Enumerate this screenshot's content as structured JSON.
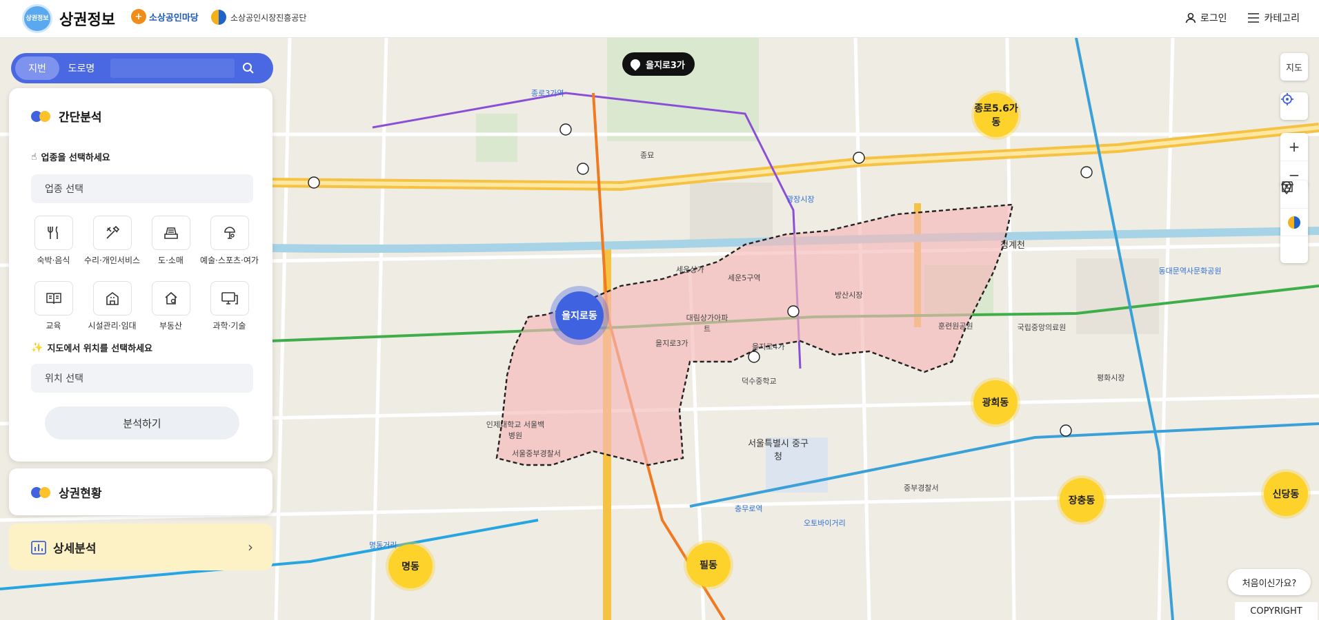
{
  "header": {
    "logo_badge": "상권정보",
    "title": "상권정보",
    "partner1": "소상공인마당",
    "partner2": "소상공인시장진흥공단",
    "login": "로그인",
    "category": "카테고리"
  },
  "search": {
    "tab_jibun": "지번",
    "tab_road": "도로명",
    "placeholder": ""
  },
  "quick": {
    "title": "간단분석",
    "industry_prompt": "업종을 선택하세요",
    "industry_field": "업종 선택",
    "categories": [
      {
        "label": "숙박·음식",
        "icon": "utensils-icon"
      },
      {
        "label": "수리·개인서비스",
        "icon": "tools-icon"
      },
      {
        "label": "도·소매",
        "icon": "register-icon"
      },
      {
        "label": "예술·스포츠·여가",
        "icon": "leisure-icon"
      },
      {
        "label": "교육",
        "icon": "book-icon"
      },
      {
        "label": "시설관리·임대",
        "icon": "building-icon"
      },
      {
        "label": "부동산",
        "icon": "house-icon"
      },
      {
        "label": "과학·기술",
        "icon": "monitor-icon"
      }
    ],
    "location_prompt": "지도에서 위치를 선택하세요",
    "location_field": "위치 선택",
    "analyze_button": "분석하기"
  },
  "status_panel": {
    "title": "상권현황"
  },
  "detail_panel": {
    "title": "상세분석"
  },
  "map": {
    "pin_label": "을지로3가",
    "selected_area": "을지로동",
    "areas": [
      "종로5.6가동",
      "광희동",
      "장충동",
      "신당동",
      "명동",
      "필동"
    ],
    "labels": [
      "청계천",
      "종로3가역",
      "을지로3가",
      "을지로4가",
      "세운5구역",
      "동대문역사문화공원",
      "서울특별시 중구청",
      "광장시장",
      "충무로역",
      "명동거리",
      "방산시장",
      "덕수중학교",
      "서울중부경찰서",
      "인제대학교 서울백병원",
      "훈련원공원",
      "중부경찰서",
      "종묘",
      "국립중앙의료원",
      "세운상가",
      "대림상가아파트",
      "오토바이거리",
      "평화시장"
    ],
    "controls": {
      "map": "지도"
    },
    "first_visit": "처음이신가요?",
    "copyright": "COPYRIGHT"
  },
  "colors": {
    "accent": "#4a68e2",
    "area": "#fdd22a",
    "selected": "#3f63e0",
    "region": "#f6c6c6"
  }
}
